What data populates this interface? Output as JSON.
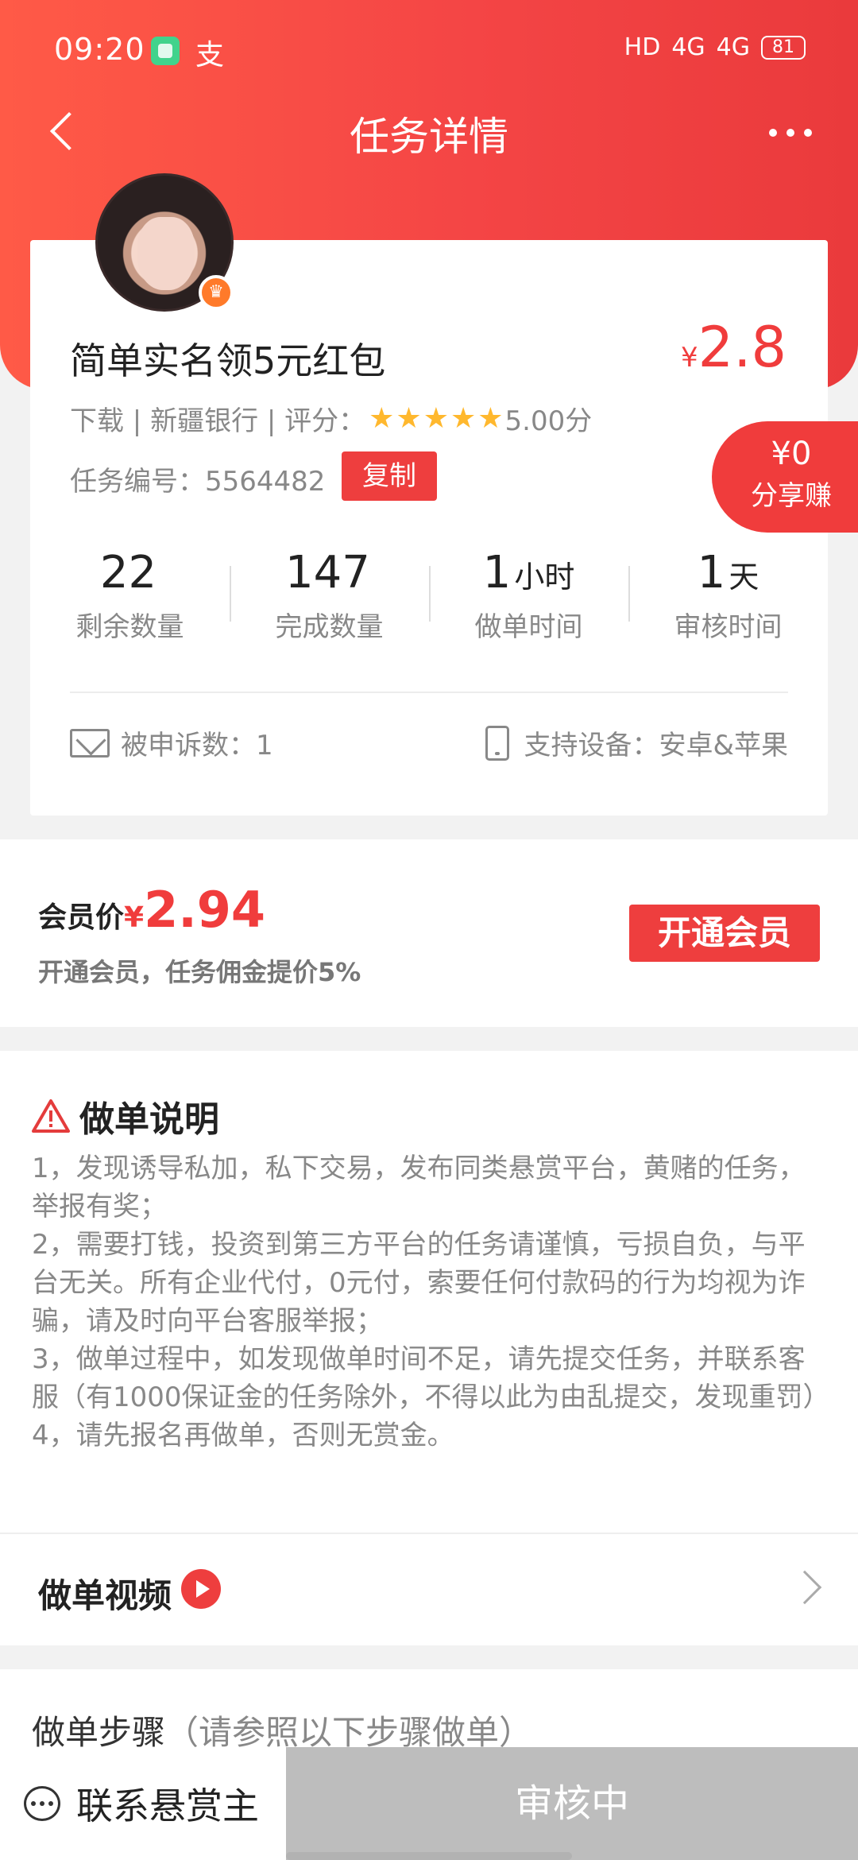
{
  "status_bar": {
    "time": "09:20",
    "app2_icon": "支",
    "network": "HD",
    "sig1": "4G",
    "sig2": "4G",
    "battery": "81"
  },
  "nav": {
    "title": "任务详情"
  },
  "task": {
    "title": "简单实名领5元红包",
    "price_symbol": "¥",
    "price": "2.8",
    "meta_prefix": "下载 | 新疆银行 | 评分：",
    "rating_stars": 5,
    "rating_text": "5.00分",
    "task_no": "任务编号：5564482",
    "copy_label": "复制"
  },
  "share": {
    "value": "¥0",
    "label": "分享赚"
  },
  "stats": [
    {
      "num": "22",
      "unit": "",
      "label": "剩余数量"
    },
    {
      "num": "147",
      "unit": "",
      "label": "完成数量"
    },
    {
      "num": "1",
      "unit": "小时",
      "label": "做单时间"
    },
    {
      "num": "1",
      "unit": "天",
      "label": "审核时间"
    }
  ],
  "complaints": "被申诉数：1",
  "devices": "支持设备：安卓&苹果",
  "vip": {
    "label": "会员价",
    "symbol": "¥",
    "price": "2.94",
    "note": "开通会员，任务佣金提价5%",
    "button": "开通会员"
  },
  "instructions": {
    "title": "做单说明",
    "items": [
      "1，发现诱导私加，私下交易，发布同类悬赏平台，黄赌的任务，举报有奖；",
      "2，需要打钱，投资到第三方平台的任务请谨慎，亏损自负，与平台无关。所有企业代付，0元付，索要任何付款码的行为均视为诈骗，请及时向平台客服举报；",
      "3，做单过程中，如发现做单时间不足，请先提交任务，并联系客服（有1000保证金的任务除外，不得以此为由乱提交，发现重罚）",
      "4，请先报名再做单，否则无赏金。"
    ]
  },
  "video": {
    "title": "做单视频"
  },
  "steps": {
    "title": "做单步骤",
    "subtitle": "（请参照以下步骤做单）"
  },
  "bottom": {
    "contact": "联系悬赏主",
    "status": "审核中"
  },
  "colors": {
    "brand_red": "#f03c3c",
    "star": "#ffb82e",
    "disabled": "#bdbdbd"
  }
}
